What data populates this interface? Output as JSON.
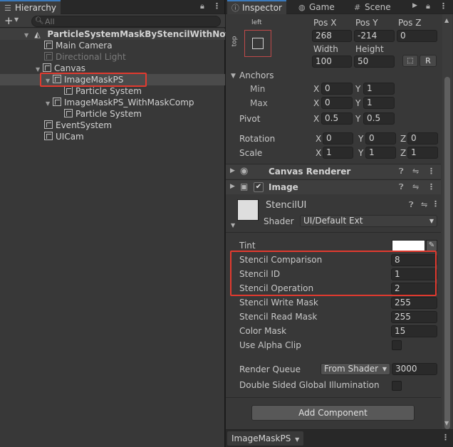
{
  "hierarchy": {
    "tab_label": "Hierarchy",
    "search_placeholder": "All",
    "scene_name": "ParticleSystemMaskByStencilWithNotS",
    "items": [
      {
        "label": "Main Camera"
      },
      {
        "label": "Directional Light"
      },
      {
        "label": "Canvas"
      },
      {
        "label": "ImageMaskPS"
      },
      {
        "label": "Particle System"
      },
      {
        "label": "ImageMaskPS_WithMaskComp"
      },
      {
        "label": "Particle System"
      },
      {
        "label": "EventSystem"
      },
      {
        "label": "UICam"
      }
    ]
  },
  "inspector": {
    "tabs": [
      "Inspector",
      "Game",
      "Scene"
    ],
    "rect_transform": {
      "anchor_preset_top": "left",
      "anchor_preset_side": "top",
      "pos_x_label": "Pos X",
      "pos_y_label": "Pos Y",
      "pos_z_label": "Pos Z",
      "pos_x": "268",
      "pos_y": "-214",
      "pos_z": "0",
      "width_label": "Width",
      "height_label": "Height",
      "width": "100",
      "height": "50",
      "r_button": "R",
      "anchors_label": "Anchors",
      "min_label": "Min",
      "max_label": "Max",
      "min_x": "0",
      "min_y": "1",
      "max_x": "0",
      "max_y": "1",
      "pivot_label": "Pivot",
      "pivot_x": "0.5",
      "pivot_y": "0.5",
      "rotation_label": "Rotation",
      "rot_x": "0",
      "rot_y": "0",
      "rot_z": "0",
      "scale_label": "Scale",
      "scale_x": "1",
      "scale_y": "1",
      "scale_z": "1",
      "axis_x": "X",
      "axis_y": "Y",
      "axis_z": "Z"
    },
    "canvas_renderer_title": "Canvas Renderer",
    "image_title": "Image",
    "material": {
      "name": "StencilUI",
      "shader_label": "Shader",
      "shader_value": "UI/Default Ext"
    },
    "properties": [
      {
        "label": "Tint",
        "value": ""
      },
      {
        "label": "Stencil Comparison",
        "value": "8"
      },
      {
        "label": "Stencil ID",
        "value": "1"
      },
      {
        "label": "Stencil Operation",
        "value": "2"
      },
      {
        "label": "Stencil Write Mask",
        "value": "255"
      },
      {
        "label": "Stencil Read Mask",
        "value": "255"
      },
      {
        "label": "Color Mask",
        "value": "15"
      },
      {
        "label": "Use Alpha Clip",
        "value": ""
      }
    ],
    "render_queue_label": "Render Queue",
    "render_queue_mode": "From Shader",
    "render_queue_value": "3000",
    "double_sided_label": "Double Sided Global Illumination",
    "add_component_label": "Add Component",
    "footer_object": "ImageMaskPS"
  },
  "colors": {
    "highlight": "#e23a2f",
    "active_tab_accent": "#3a79bb"
  }
}
